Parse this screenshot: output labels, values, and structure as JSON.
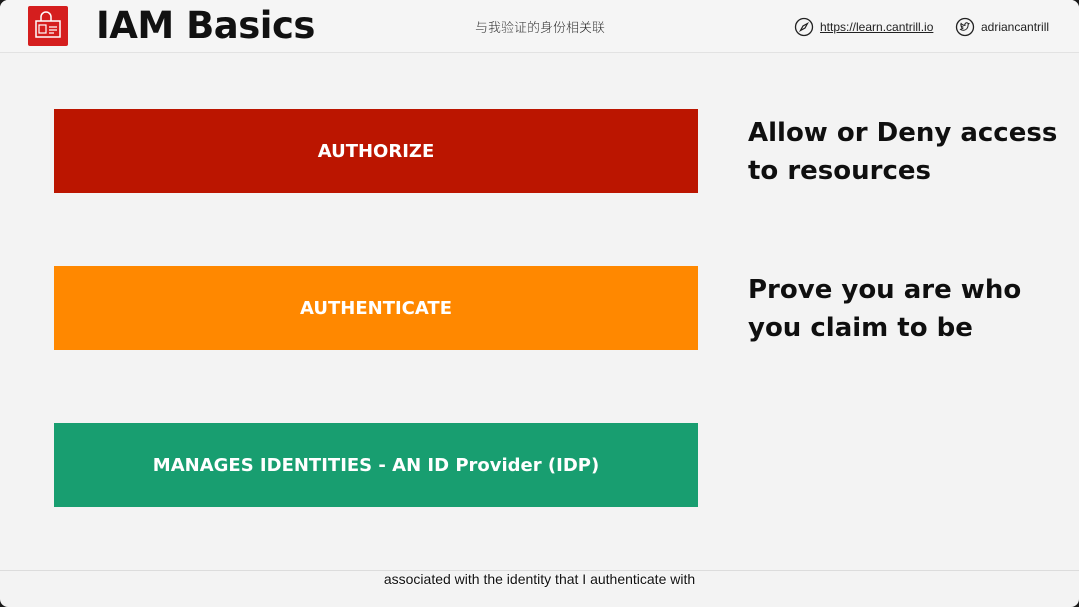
{
  "header": {
    "title": "IAM Basics",
    "subtitle_cn": "与我验证的身份相关联",
    "site_link": "https://learn.cantrill.io",
    "twitter_handle": "adriancantrill",
    "logo_icon": "iam-lock-icon",
    "site_icon": "compass-icon",
    "twitter_icon": "twitter-bird-icon"
  },
  "bars": [
    {
      "label": "AUTHORIZE",
      "color": "#bb1500"
    },
    {
      "label": "AUTHENTICATE",
      "color": "#ff8800"
    },
    {
      "label": "MANAGES IDENTITIES - AN ID Provider (IDP)",
      "color": "#189e70"
    }
  ],
  "descriptions": [
    {
      "line1": "Allow or Deny access",
      "line2": "to resources"
    },
    {
      "line1": "Prove you are who",
      "line2": "you claim to be"
    }
  ],
  "caption": "associated with the identity that I authenticate with",
  "colors": {
    "brand_red": "#d51e1e",
    "background": "#f3f3f3"
  }
}
